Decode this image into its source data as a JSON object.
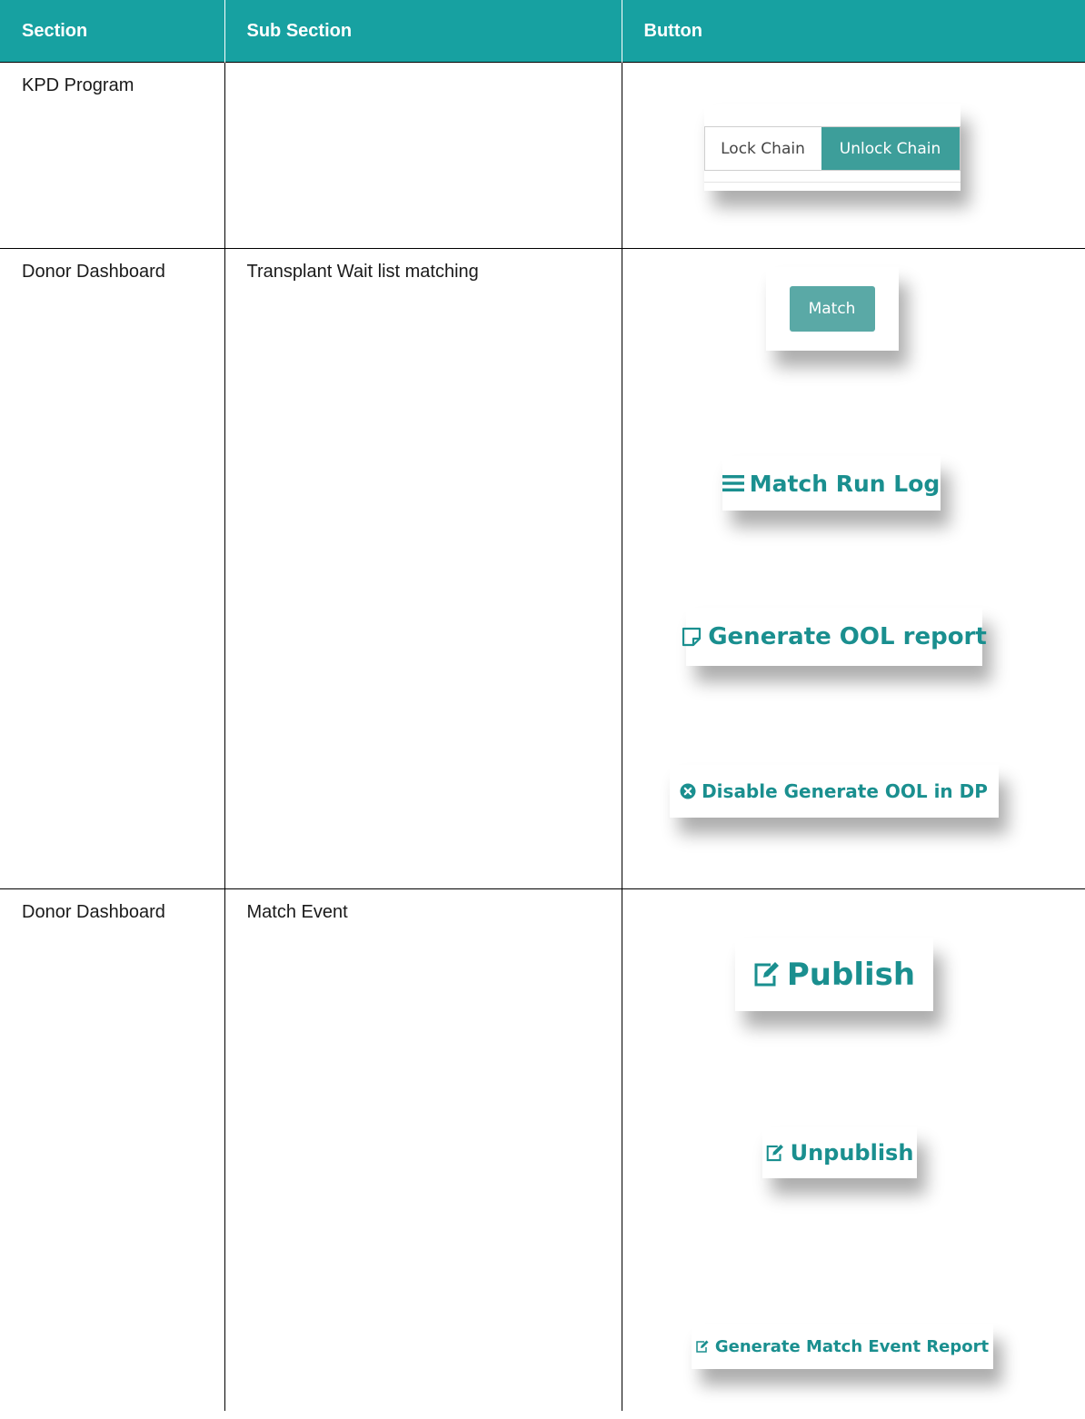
{
  "table": {
    "headers": [
      "Section",
      "Sub Section",
      "Button"
    ],
    "rows": [
      {
        "section": "KPD Program",
        "sub_section": ""
      },
      {
        "section": "Donor Dashboard",
        "sub_section": "Transplant Wait list matching"
      },
      {
        "section": "Donor Dashboard",
        "sub_section": "Match Event"
      }
    ]
  },
  "buttons": {
    "lock_chain": "Lock Chain",
    "unlock_chain": "Unlock Chain",
    "match": "Match",
    "match_run_log": "Match Run Log",
    "generate_ool_report": "Generate OOL report",
    "disable_generate_ool": "Disable Generate OOL in DP",
    "publish": "Publish",
    "unpublish": "Unpublish",
    "generate_match_event_report": "Generate Match Event Report"
  },
  "icons": {
    "match_run_log": "list-icon",
    "generate_ool_report": "note-icon",
    "disable_generate_ool": "times-circle-icon",
    "publish": "edit-icon",
    "unpublish": "edit-icon",
    "generate_match_event_report": "edit-icon"
  },
  "colors": {
    "header_bg": "#17a1a1",
    "accent_teal": "#1a8f8f",
    "unlock_bg": "#3d9e9a",
    "match_bg": "#5aa9a6"
  }
}
